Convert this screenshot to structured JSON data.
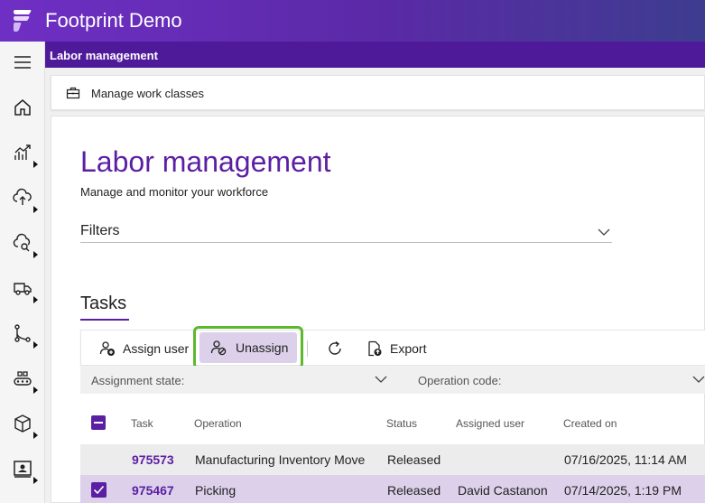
{
  "app": {
    "title": "Footprint Demo"
  },
  "section": {
    "title": "Labor management"
  },
  "subbar": {
    "manage_label": "Manage work classes"
  },
  "page": {
    "title": "Labor management",
    "subtitle": "Manage and monitor your workforce"
  },
  "filters": {
    "label": "Filters"
  },
  "tasks": {
    "title": "Tasks"
  },
  "toolbar": {
    "assign_label": "Assign user",
    "unassign_label": "Unassign",
    "export_label": "Export"
  },
  "filter_row": {
    "assignment_state": "Assignment state:",
    "operation_code": "Operation code:"
  },
  "table": {
    "headers": {
      "task": "Task",
      "operation": "Operation",
      "status": "Status",
      "assigned_user": "Assigned user",
      "created_on": "Created on"
    },
    "rows": [
      {
        "task": "975573",
        "operation": "Manufacturing Inventory Move",
        "status": "Released",
        "assigned_user": "",
        "created_on": "07/16/2025, 11:14 AM"
      },
      {
        "task": "975467",
        "operation": "Picking",
        "status": "Released",
        "assigned_user": "David Castanon",
        "created_on": "07/14/2025, 1:19 PM"
      }
    ]
  },
  "colors": {
    "brand": "#5b1fa3",
    "highlight": "#5cb82e",
    "selected_row": "#dcd0ea"
  },
  "rail_icons": [
    "menu-icon",
    "home-icon",
    "analytics-icon",
    "upload-icon",
    "cloud-search-icon",
    "truck-icon",
    "flow-icon",
    "conveyor-icon",
    "box-icon",
    "badge-icon"
  ]
}
